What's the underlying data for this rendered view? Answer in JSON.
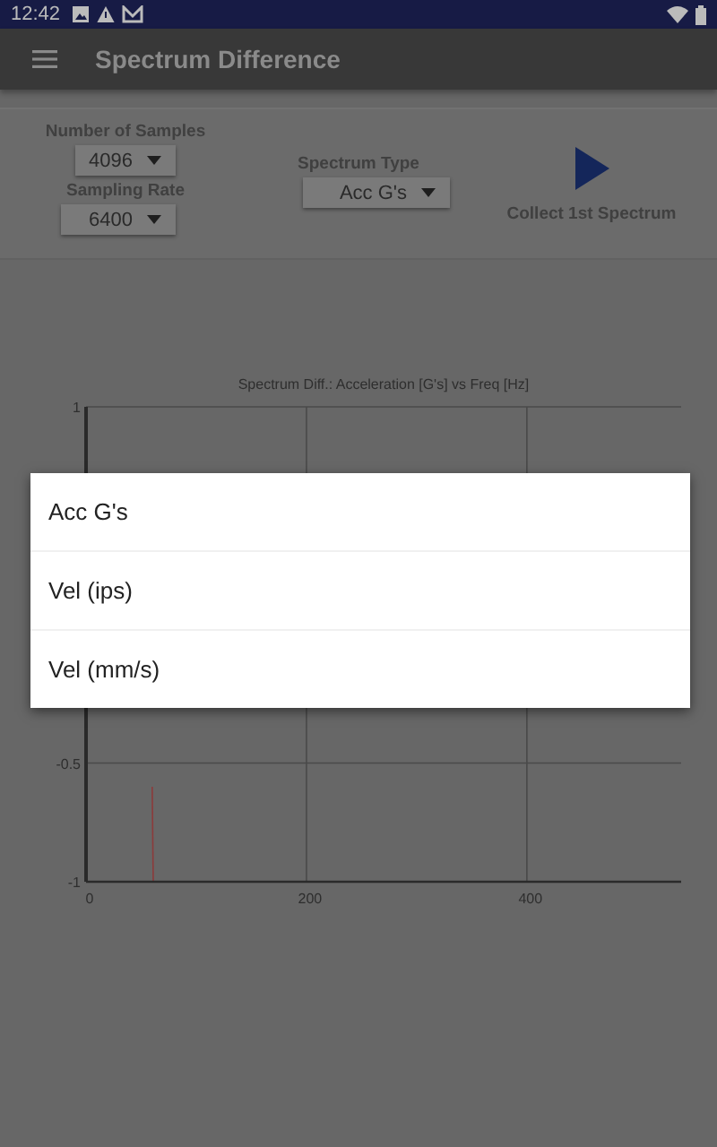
{
  "status_bar": {
    "time": "12:42"
  },
  "app_bar": {
    "title": "Spectrum Difference"
  },
  "controls": {
    "samples": {
      "label": "Number of Samples",
      "value": "4096"
    },
    "rate": {
      "label": "Sampling Rate",
      "value": "6400"
    },
    "spectrum_type": {
      "label": "Spectrum Type",
      "value": "Acc G's"
    },
    "collect": {
      "label": "Collect 1st Spectrum"
    }
  },
  "chart": {
    "chart_data": {
      "type": "line",
      "title": "Spectrum Diff.: Acceleration [G's] vs Freq [Hz]",
      "x": [
        60,
        61
      ],
      "series": [
        {
          "color": "#8c3b3b",
          "values": [
            -0.6,
            -1
          ]
        }
      ],
      "grid": true,
      "xlim": [
        0,
        540
      ],
      "ylim": [
        -1,
        1
      ],
      "xticks": [
        0,
        200,
        400
      ],
      "yticks": [
        -1,
        -0.5,
        1
      ]
    }
  },
  "dropdown_menu": {
    "items": [
      {
        "label": "Acc G's"
      },
      {
        "label": "Vel (ips)"
      },
      {
        "label": "Vel (mm/s)"
      }
    ]
  }
}
